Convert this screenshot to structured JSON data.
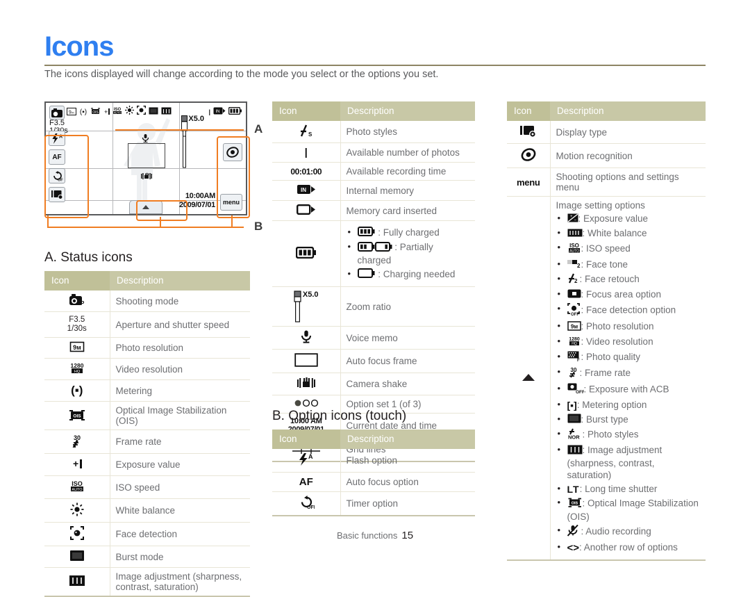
{
  "page": {
    "title": "Icons",
    "intro": "The icons displayed will change according to the mode you select or the options you set.",
    "footer_label": "Basic functions",
    "footer_page": "15",
    "accent_color": "#2f7ff0",
    "header_color": "#c0c098",
    "callout_color": "#f07d22"
  },
  "callouts": {
    "a": "A",
    "b": "B"
  },
  "lcd": {
    "aperture": "F3.5",
    "shutter": "1/30s",
    "mode_icon": "shooting-mode-icon",
    "zoom_ratio": "X5.0",
    "time": "10:00AM",
    "date": "2009/07/01",
    "menu_label": "menu",
    "left_buttons": [
      {
        "name": "flash-option-icon",
        "label": "flash"
      },
      {
        "name": "auto-focus-option-icon",
        "label": "AF"
      },
      {
        "name": "timer-option-icon",
        "label": "timer"
      },
      {
        "name": "display-type-icon",
        "label": "display"
      }
    ],
    "right_buttons": [
      {
        "name": "motion-recognition-icon",
        "label": "motion"
      },
      {
        "name": "menu-button",
        "label": "menu"
      }
    ],
    "top_left_icons": [
      "shooting-mode-icon",
      "photo-resolution-icon",
      "metering-icon",
      "ois-icon",
      "exposure-value-icon"
    ],
    "top_mid_icons": [
      "iso-speed-icon",
      "white-balance-icon",
      "face-detection-icon",
      "burst-mode-icon",
      "image-adjustment-icon"
    ],
    "top_right_icons": [
      "available-photos-icon",
      "internal-memory-icon",
      "battery-icon"
    ]
  },
  "section_a": {
    "heading": "A. Status icons",
    "columns": [
      "Icon",
      "Description"
    ],
    "rows": [
      {
        "icon": "shooting-mode-icon",
        "icon_text": "",
        "desc": "Shooting mode"
      },
      {
        "icon": "aperture-shutter-icon",
        "icon_text": "F3.5 / 1/30s",
        "desc": "Aperture and shutter speed"
      },
      {
        "icon": "photo-resolution-icon",
        "icon_text": "",
        "desc": "Photo resolution"
      },
      {
        "icon": "video-resolution-icon",
        "icon_text": "",
        "desc": "Video resolution"
      },
      {
        "icon": "metering-icon",
        "icon_text": "",
        "desc": "Metering"
      },
      {
        "icon": "ois-icon",
        "icon_text": "",
        "desc": "Optical Image Stabilization (OIS)"
      },
      {
        "icon": "frame-rate-icon",
        "icon_text": "",
        "desc": "Frame rate"
      },
      {
        "icon": "exposure-value-icon",
        "icon_text": "",
        "desc": "Exposure value"
      },
      {
        "icon": "iso-speed-icon",
        "icon_text": "",
        "desc": "ISO speed"
      },
      {
        "icon": "white-balance-icon",
        "icon_text": "",
        "desc": "White balance"
      },
      {
        "icon": "face-detection-icon",
        "icon_text": "",
        "desc": "Face detection"
      },
      {
        "icon": "burst-mode-icon",
        "icon_text": "",
        "desc": "Burst mode"
      },
      {
        "icon": "image-adjustment-icon",
        "icon_text": "",
        "desc": "Image adjustment (sharpness, contrast, saturation)"
      }
    ]
  },
  "table_mid": {
    "columns": [
      "Icon",
      "Description"
    ],
    "rows": [
      {
        "icon": "photo-styles-icon",
        "desc": "Photo styles"
      },
      {
        "icon": "available-photos-icon",
        "desc": "Available number of photos"
      },
      {
        "icon": "recording-time-icon",
        "icon_text": "00:01:00",
        "desc": "Available recording time"
      },
      {
        "icon": "internal-memory-icon",
        "desc": "Internal memory"
      },
      {
        "icon": "memory-card-icon",
        "desc": "Memory card inserted"
      },
      {
        "icon": "battery-icon",
        "desc": "",
        "bullets": [
          ": Fully charged",
          ": Partially charged",
          ": Charging needed"
        ]
      },
      {
        "icon": "zoom-ratio-icon",
        "icon_text": "X5.0",
        "desc": "Zoom ratio"
      },
      {
        "icon": "voice-memo-icon",
        "desc": "Voice memo"
      },
      {
        "icon": "auto-focus-frame-icon",
        "desc": "Auto focus frame"
      },
      {
        "icon": "camera-shake-icon",
        "desc": "Camera shake"
      },
      {
        "icon": "option-set-icon",
        "desc": "Option set 1  (of 3)"
      },
      {
        "icon": "date-time-icon",
        "icon_text": "10:00 AM / 2009/07/01",
        "desc": "Current date and time"
      },
      {
        "icon": "grid-lines-icon",
        "desc": "Grid lines"
      }
    ]
  },
  "section_b": {
    "heading": "B. Option icons (touch)",
    "columns": [
      "Icon",
      "Description"
    ],
    "rows": [
      {
        "icon": "flash-option-icon",
        "desc": "Flash option"
      },
      {
        "icon": "auto-focus-option-icon",
        "desc": "Auto focus option"
      },
      {
        "icon": "timer-option-icon",
        "desc": "Timer option"
      }
    ]
  },
  "table_right": {
    "columns": [
      "Icon",
      "Description"
    ],
    "rows": [
      {
        "icon": "display-type-icon",
        "desc": "Display type"
      },
      {
        "icon": "motion-recognition-icon",
        "desc": "Motion recognition"
      },
      {
        "icon": "menu-icon",
        "icon_text": "menu",
        "desc": "Shooting options and settings menu"
      }
    ],
    "options_block": {
      "icon": "up-arrow-icon",
      "title": "Image setting options",
      "items": [
        {
          "icon": "exposure-value-icon",
          "label": ": Exposure value"
        },
        {
          "icon": "white-balance-option-icon",
          "label": ": White balance"
        },
        {
          "icon": "iso-speed-icon",
          "label": ": ISO speed"
        },
        {
          "icon": "face-tone-icon",
          "label": ": Face tone"
        },
        {
          "icon": "face-retouch-icon",
          "label": ": Face retouch"
        },
        {
          "icon": "focus-area-icon",
          "label": ": Focus area option"
        },
        {
          "icon": "face-detection-option-icon",
          "label": ": Face detection option"
        },
        {
          "icon": "photo-resolution-icon",
          "label": ": Photo resolution"
        },
        {
          "icon": "video-resolution-icon",
          "label": ": Video resolution"
        },
        {
          "icon": "photo-quality-icon",
          "label": ": Photo quality"
        },
        {
          "icon": "frame-rate-icon",
          "label": ": Frame rate"
        },
        {
          "icon": "acb-exposure-icon",
          "label": ": Exposure with ACB"
        },
        {
          "icon": "metering-option-icon",
          "label": ": Metering option"
        },
        {
          "icon": "burst-type-icon",
          "label": ": Burst type"
        },
        {
          "icon": "photo-styles-nor-icon",
          "label": ": Photo styles"
        },
        {
          "icon": "image-adjustment-icon",
          "label": ": Image adjustment (sharpness, contrast, saturation)"
        },
        {
          "icon": "long-time-shutter-icon",
          "label": ": Long time shutter"
        },
        {
          "icon": "ois-icon",
          "label": ": Optical Image Stabilization (OIS)"
        },
        {
          "icon": "audio-recording-icon",
          "label": ": Audio recording"
        },
        {
          "icon": "another-row-icon",
          "label": ": Another row of options"
        }
      ]
    }
  }
}
